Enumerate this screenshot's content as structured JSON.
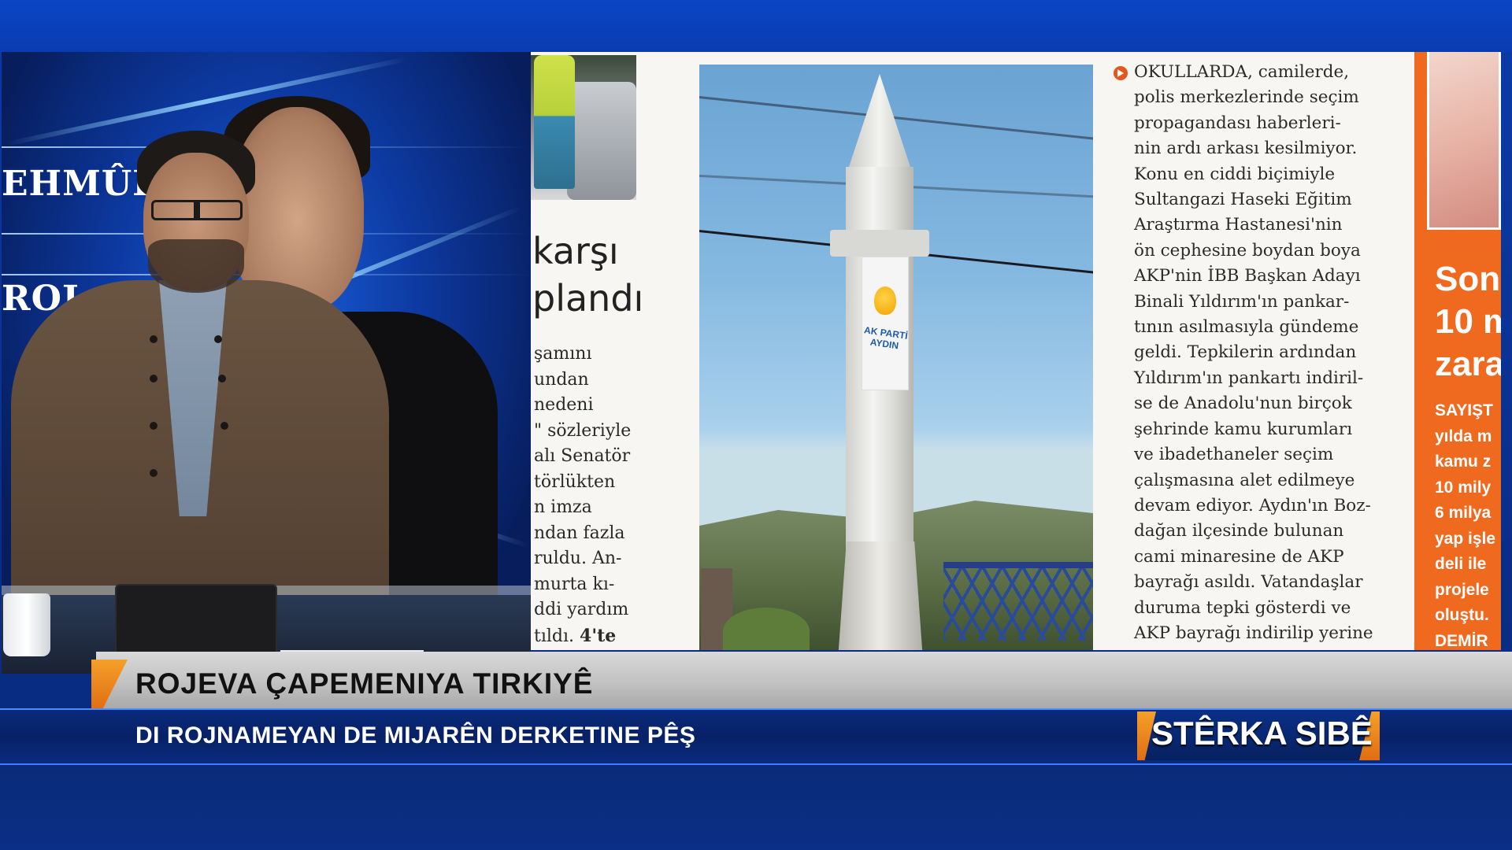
{
  "studio": {
    "backdrop_name_1": "EHMÛD",
    "backdrop_name_2": "ROJ"
  },
  "newspaper": {
    "left_headline_1": "karşı",
    "left_headline_2": "plandı",
    "left_lines": [
      "şamını",
      "undan",
      " nedeni",
      "\" sözleriyle",
      "alı Senatör",
      "törlükten",
      "n imza",
      "ndan fazla",
      "ruldu. An-",
      "murta kı-",
      "ddi yardım",
      "tıldı."
    ],
    "left_page_ref": "4'te",
    "photo_banner_text": "AK PARTİ AYDIN",
    "article_lines": [
      "OKULLARDA, camilerde,",
      "polis merkezlerinde seçim",
      "propagandası haberleri-",
      "nin ardı arkası kesilmiyor.",
      "Konu en ciddi biçimiyle",
      "Sultangazi Haseki Eğitim",
      "Araştırma Hastanesi'nin",
      "ön cephesine boydan boya",
      "AKP'nin İBB Başkan Adayı",
      "Binali Yıldırım'ın pankar-",
      "tının asılmasıyla gündeme",
      "geldi. Tepkilerin ardından",
      "Yıldırım'ın pankartı indiril-",
      "se de Anadolu'nun birçok",
      "şehrinde kamu kurumları",
      "ve ibadethaneler seçim",
      "çalışmasına alet edilmeye",
      "devam ediyor. Aydın'ın Boz-",
      "dağan ilçesinde bulunan",
      "cami minaresine de AKP",
      "bayrağı asıldı. Vatandaşlar",
      "duruma tepki gösterdi ve",
      "AKP bayrağı indirilip yerine"
    ],
    "side_big": [
      "Son",
      "10 m",
      "zara"
    ],
    "side_small": [
      "SAYIŞT",
      "yılda m",
      "kamu z",
      "10 mily",
      "6 milya",
      "yap işle",
      "deli ile",
      "projele",
      "oluştu.",
      "DEMİR"
    ]
  },
  "lower_third": {
    "title": "ROJEVA ÇAPEMENIYA TIRKIYÊ",
    "subtitle": "DI ROJNAMEYAN DE MIJARÊN DERKETINE PÊŞ",
    "program_logo": "STÊRKA SIBÊ"
  },
  "colors": {
    "accent_orange": "#e06d14",
    "brand_blue": "#0a2f8a",
    "lower_third_grey": "#c2c2c2"
  }
}
